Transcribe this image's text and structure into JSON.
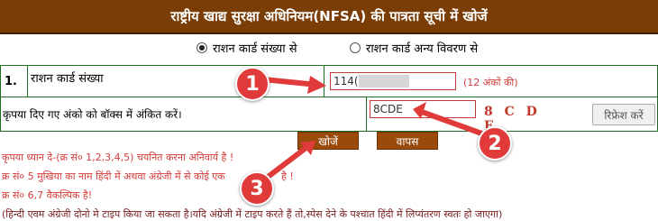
{
  "header": {
    "title": "राष्ट्रीय खाद्य सुरक्षा अधिनियम(NFSA) की पात्रता सूची में खोजें"
  },
  "radio": {
    "option1": "राशन कार्ड संख्या से",
    "option2": "राशन कार्ड अन्य विवरण से",
    "selected": "option1"
  },
  "form": {
    "row_number": "1.",
    "ration_label": "राशन कार्ड संख्या",
    "ration_value": "114(",
    "ration_hint": "(12 अंकों की)",
    "captcha_label": "कृपया दिए गए अंको को बॉक्स में अंकित करें।",
    "captcha_value": "8CDE",
    "captcha_text": "8 C D E",
    "refresh_label": "रिफ्रेश करें"
  },
  "buttons": {
    "search": "खोजें",
    "back": "वापस"
  },
  "notes": [
    "कृपया ध्यान दे-(क्र सं० 1,2,3,4,5) चयनित करना अनिवार्य है !",
    "क्र सं० 5 मुखिया का नाम हिंदी में अथवा अंग्रेजी में से कोई एक",
    "क्र सं० 6,7 वैकल्पिक है!",
    "(हिन्दी एवम अंग्रेजी दोनो मे टाइप किया जा सकता है।यदि अंग्रेजी में टाइप करते हैं तो,स्पेस देने के पश्चात हिंदी में लिप्यंतरण स्वतः हो जाएगा)"
  ],
  "note2_tail": "है !",
  "badges": [
    "1",
    "2",
    "3"
  ],
  "colors": {
    "header_bg": "#7a3d06",
    "border_green": "#1f6e1f",
    "hint_red": "#d43c3c",
    "badge_red": "#e03a3a"
  }
}
